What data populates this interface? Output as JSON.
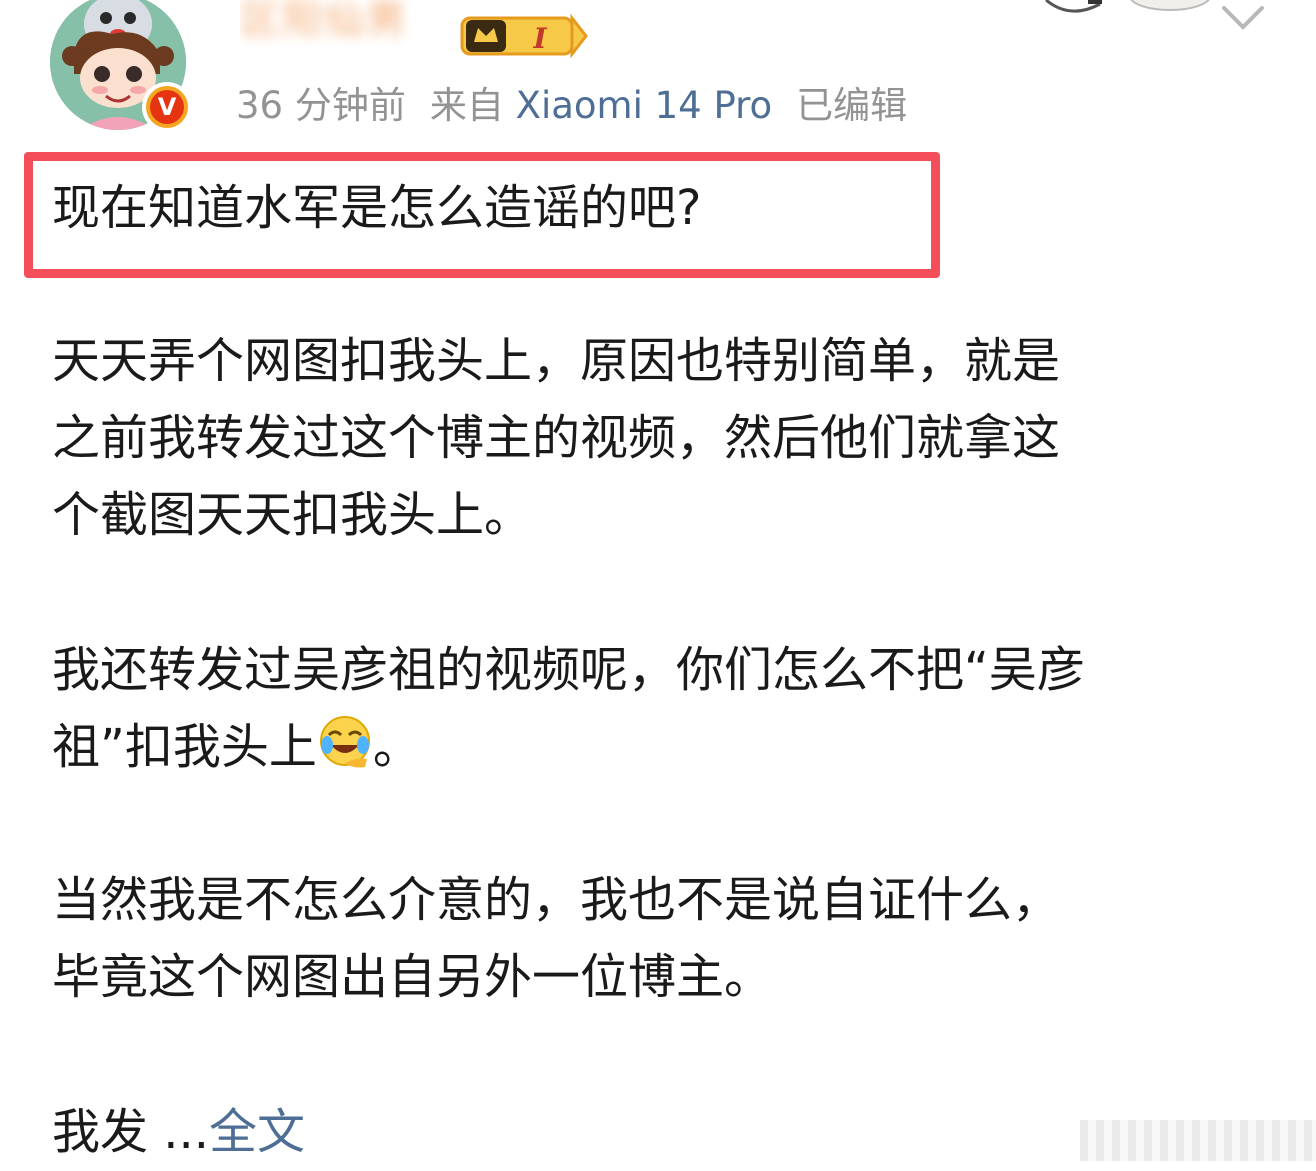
{
  "post": {
    "username": "区阳仙男",
    "time_ago": "36 分钟前",
    "from_label": "来自",
    "device": "Xiaomi 14 Pro",
    "edited": "已编辑",
    "level_badge": "I",
    "verified_mark": "V",
    "highlight_text": "现在知道水军是怎么造谣的吧?",
    "paragraphs": [
      [
        "天天弄个网图扣我头上，原因也特别简单，就是",
        "之前我转发过这个博主的视频，然后他们就拿这",
        "个截图天天扣我头上。"
      ],
      [
        "我还转发过吴彦祖的视频呢，你们怎么不把“吴彦",
        "祖”扣我头上"
      ],
      [
        "当然我是不怎么介意的，我也不是说自证什么，",
        "毕竟这个网图出自另外一位博主。"
      ]
    ],
    "emoji_after_line": "。",
    "last_line_prefix": "我发 ...",
    "read_more": "全文"
  },
  "icons": {
    "verified": "verified-v-icon",
    "level": "crown-level-badge-icon",
    "expand": "chevron-down-icon",
    "emoji": "laugh-cry-emoji-icon"
  },
  "colors": {
    "highlight_border": "#f44e5b",
    "link": "#4e6e96",
    "meta": "#939393",
    "verified_bg": "#f5a623"
  }
}
